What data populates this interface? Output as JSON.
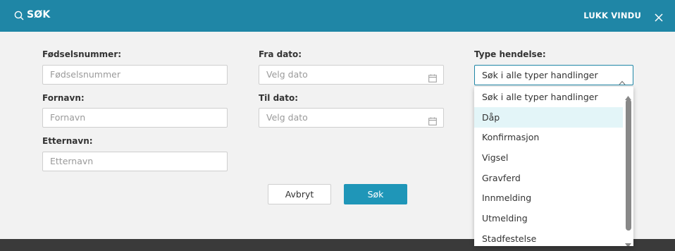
{
  "header": {
    "title": "SØK",
    "close_label": "LUKK VINDU"
  },
  "form": {
    "ssn": {
      "label": "Fødselsnummer:",
      "placeholder": "Fødselsnummer"
    },
    "firstname": {
      "label": "Fornavn:",
      "placeholder": "Fornavn"
    },
    "lastname": {
      "label": "Etternavn:",
      "placeholder": "Etternavn"
    },
    "from_date": {
      "label": "Fra dato:",
      "placeholder": "Velg dato"
    },
    "to_date": {
      "label": "Til dato:",
      "placeholder": "Velg dato"
    },
    "event_type": {
      "label": "Type hendelse:",
      "selected": "Søk i alle typer handlinger",
      "options": [
        "Søk i alle typer handlinger",
        "Dåp",
        "Konfirmasjon",
        "Vigsel",
        "Gravferd",
        "Innmelding",
        "Utmelding",
        "Stadfestelse"
      ],
      "highlighted": "Dåp"
    }
  },
  "buttons": {
    "cancel": "Avbryt",
    "submit": "Søk"
  },
  "colors": {
    "header": "#1f86a6",
    "primary": "#1f96b8",
    "highlight": "#e3f5f8"
  }
}
